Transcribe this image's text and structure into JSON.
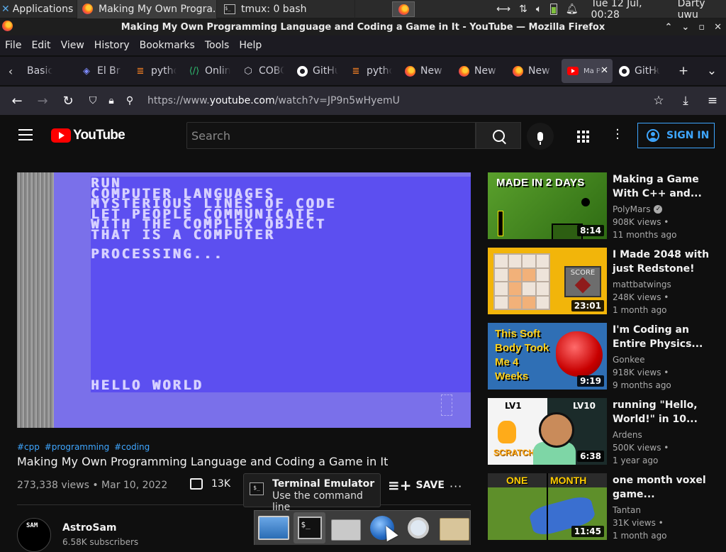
{
  "panel": {
    "applications_label": "Applications",
    "tasks": [
      {
        "label": "Making My Own Progra..."
      },
      {
        "label": "tmux: 0 bash"
      }
    ],
    "clock": "Tue 12 Jul, 00:28",
    "user": "Darty uwu"
  },
  "window": {
    "title": "Making My Own Programming Language and Coding a Game in It - YouTube — Mozilla Firefox"
  },
  "menu": [
    "File",
    "Edit",
    "View",
    "History",
    "Bookmarks",
    "Tools",
    "Help"
  ],
  "tabs": [
    {
      "label": "Basic",
      "icon": "none"
    },
    {
      "label": "El Br",
      "icon": "discord-icon"
    },
    {
      "label": "pytho",
      "icon": "stackoverflow-icon"
    },
    {
      "label": "Onlin",
      "icon": "code-icon"
    },
    {
      "label": "COBO",
      "icon": "cobol-icon"
    },
    {
      "label": "GitHu",
      "icon": "github-icon"
    },
    {
      "label": "pytho",
      "icon": "stackoverflow-icon"
    },
    {
      "label": "New",
      "icon": "firefox-icon"
    },
    {
      "label": "New",
      "icon": "firefox-icon"
    },
    {
      "label": "New",
      "icon": "firefox-icon"
    },
    {
      "label": "Ma PLA",
      "icon": "youtube-icon",
      "active": true
    },
    {
      "label": "GitHu",
      "icon": "github-icon"
    }
  ],
  "url": {
    "prefix": "https://www.",
    "domain": "youtube.com",
    "path": "/watch?v=JP9n5wHyemU"
  },
  "youtube": {
    "logo_text": "YouTube",
    "search_placeholder": "Search",
    "signin_label": "SIGN IN"
  },
  "video_screen": {
    "lines": "RUN\nCOMPUTER LANGUAGES\nMYSTERIOUS LINES OF CODE\nLET PEOPLE COMMUNICATE\nWITH THE COMPLEX OBJECT\nTHAT IS A COMPUTER",
    "processing": "PROCESSING...",
    "hello": "HELLO WORLD"
  },
  "video": {
    "hashtags": [
      "#cpp",
      "#programming",
      "#coding"
    ],
    "title": "Making My Own Programming Language and Coding a Game in It",
    "views_date": "273,338 views • Mar 10, 2022",
    "likes": "13K",
    "save_label": "SAVE",
    "channel": {
      "name": "AstroSam",
      "subscribers": "6.58K subscribers",
      "avatar_text": "SAM"
    }
  },
  "recommendations": [
    {
      "title": "Making a Game With C++ and...",
      "channel": "PolyMars",
      "verified": true,
      "views": "908K views •",
      "age": "11 months ago",
      "duration": "8:14",
      "thumb_text": "MADE IN 2 DAYS"
    },
    {
      "title": "I Made 2048 with just Redstone!",
      "channel": "mattbatwings",
      "verified": false,
      "views": "248K views •",
      "age": "1 month ago",
      "duration": "23:01",
      "thumb_text": "SCORE"
    },
    {
      "title": "I'm Coding an Entire Physics...",
      "channel": "Gonkee",
      "verified": false,
      "views": "918K views •",
      "age": "9 months ago",
      "duration": "9:19",
      "thumb_text": "This Soft Body Took Me 4 Weeks"
    },
    {
      "title": "running \"Hello, World!\" in 10...",
      "channel": "Ardens",
      "verified": false,
      "views": "500K views •",
      "age": "1 year ago",
      "duration": "6:38",
      "thumb_text_left": "LV1",
      "thumb_text_right": "LV10",
      "thumb_scratch": "SCRATCH"
    },
    {
      "title": "one month voxel game...",
      "channel": "Tantan",
      "verified": false,
      "views": "31K views •",
      "age": "1 month ago",
      "duration": "11:45",
      "thumb_text_left": "ONE",
      "thumb_text_right": "MONTH"
    }
  ],
  "tooltip": {
    "title": "Terminal Emulator",
    "subtitle": "Use the command line"
  },
  "colors": {
    "accent": "#3ea6ff",
    "youtube_red": "#ff0000",
    "c64_blue": "#5c4ff0"
  }
}
